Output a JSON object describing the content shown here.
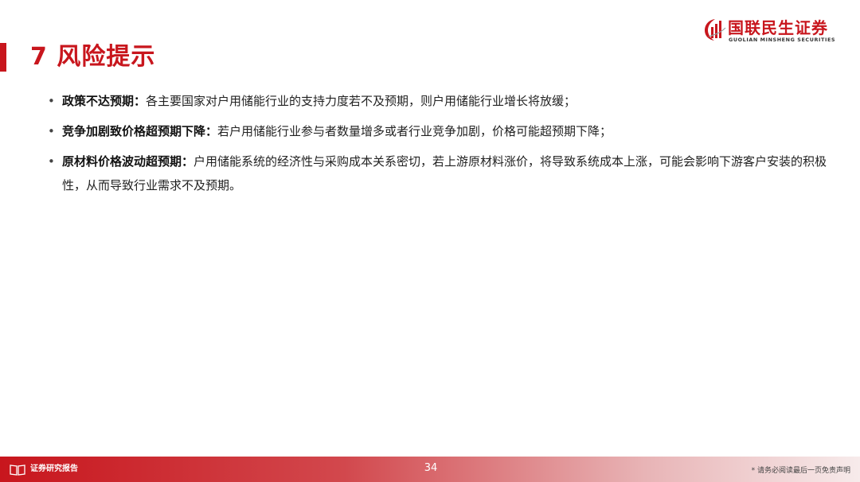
{
  "header": {
    "title": "7 风险提示",
    "logo_cn": "国联民生证券",
    "logo_en": "GUOLIAN MINSHENG SECURITIES",
    "accent_color": "#c8161d"
  },
  "bullets": [
    {
      "head": "政策不达预期：",
      "text": "各主要国家对户用储能行业的支持力度若不及预期，则户用储能行业增长将放缓；"
    },
    {
      "head": "竞争加剧致价格超预期下降：",
      "text": "若户用储能行业参与者数量增多或者行业竞争加剧，价格可能超预期下降；"
    },
    {
      "head": "原材料价格波动超预期：",
      "text": "户用储能系统的经济性与采购成本关系密切，若上游原材料涨价，将导致系统成本上涨，可能会影响下游客户安装的积极性，从而导致行业需求不及预期。"
    }
  ],
  "footer": {
    "left_label": "证券研究报告",
    "page_number": "34",
    "disclaimer": "* 请务必阅读最后一页免责声明",
    "icon": "book-icon"
  }
}
